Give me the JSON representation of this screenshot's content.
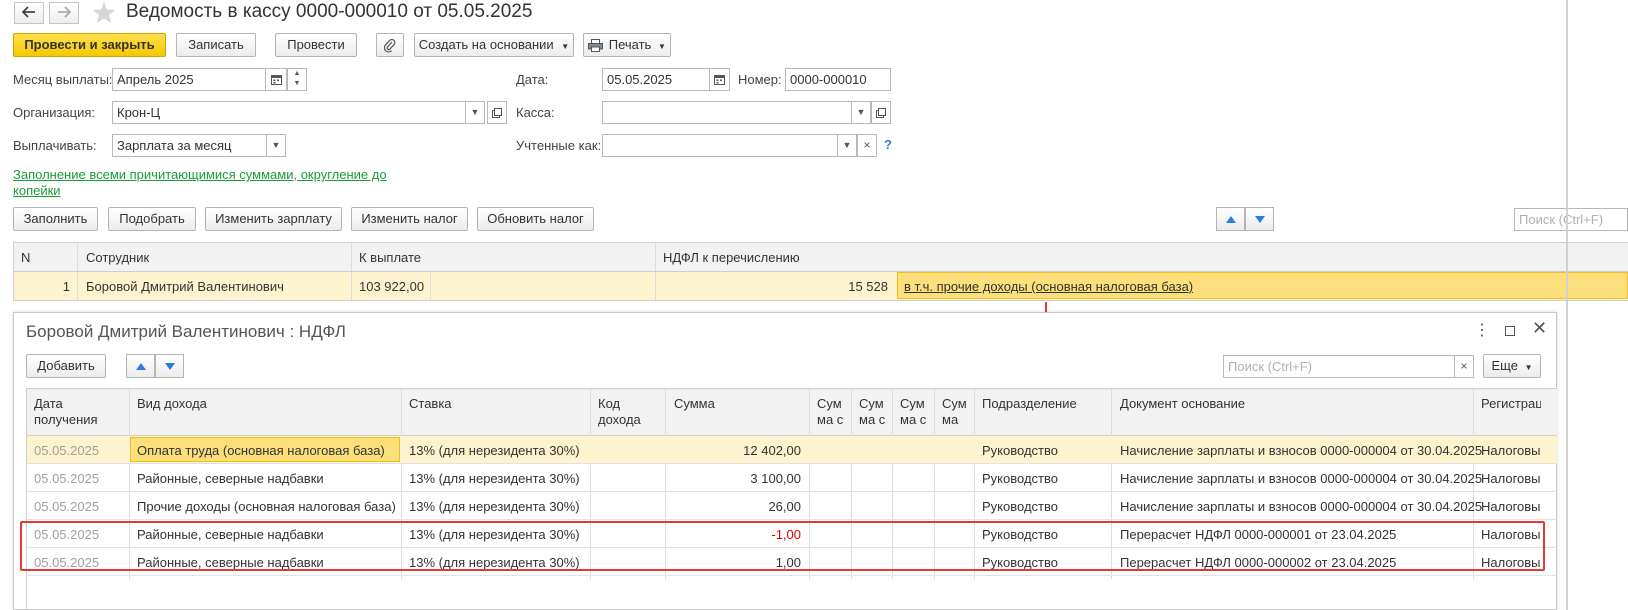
{
  "window": {
    "title": "Ведомость в кассу 0000-000010 от 05.05.2025"
  },
  "toolbar": {
    "post_close": "Провести и закрыть",
    "save": "Записать",
    "post": "Провести",
    "create_based": "Создать на основании",
    "print": "Печать"
  },
  "form": {
    "month_label": "Месяц выплаты:",
    "month_value": "Апрель 2025",
    "org_label": "Организация:",
    "org_value": "Крон-Ц",
    "pay_label": "Выплачивать:",
    "pay_value": "Зарплата за месяц",
    "date_label": "Дата:",
    "date_value": "05.05.2025",
    "number_label": "Номер:",
    "number_value": "0000-000010",
    "cash_label": "Касса:",
    "cash_value": "",
    "accounted_label": "Учтенные как:",
    "accounted_value": "",
    "help": "?",
    "fill_link": "Заполнение всеми причитающимися суммами, округление до копейки"
  },
  "actions": {
    "fill": "Заполнить",
    "pick": "Подобрать",
    "change_salary": "Изменить зарплату",
    "change_tax": "Изменить налог",
    "refresh_tax": "Обновить налог",
    "search_placeholder": "Поиск (Ctrl+F)"
  },
  "main_table": {
    "headers": [
      "N",
      "Сотрудник",
      "К выплате",
      "НДФЛ к перечислению"
    ],
    "row": {
      "n": "1",
      "employee": "Боровой Дмитрий Валентинович",
      "to_pay": "103 922,00",
      "ndfl": "15 528",
      "link": "в т.ч. прочие доходы (основная налоговая база)"
    }
  },
  "subform": {
    "title": "Боровой Дмитрий Валентинович : НДФЛ",
    "add": "Добавить",
    "search_placeholder": "Поиск (Ctrl+F)",
    "clear": "×",
    "more": "Еще",
    "headers": {
      "date": "Дата получения",
      "kind": "Вид дохода",
      "rate": "Ставка",
      "code": "Код дохода",
      "sum": "Сумма",
      "s1": "Сум ма с",
      "s2": "Сум ма с",
      "s3": "Сум ма с",
      "s4": "Сум ма",
      "dept": "Подразделение",
      "doc": "Документ основание",
      "reg": "Регистрац"
    },
    "rows": [
      {
        "date": "05.05.2025",
        "kind": "Оплата труда (основная налоговая база)",
        "rate": "13% (для нерезидента 30%)",
        "sum": "12 402,00",
        "dept": "Руководство",
        "doc": "Начисление зарплаты и взносов 0000-000004 от 30.04.2025",
        "reg": "Налоговый"
      },
      {
        "date": "05.05.2025",
        "kind": "Районные, северные надбавки",
        "rate": "13% (для нерезидента 30%)",
        "sum": "3 100,00",
        "dept": "Руководство",
        "doc": "Начисление зарплаты и взносов 0000-000004 от 30.04.2025",
        "reg": "Налоговый"
      },
      {
        "date": "05.05.2025",
        "kind": "Прочие доходы (основная налоговая база)",
        "rate": "13% (для нерезидента 30%)",
        "sum": "26,00",
        "dept": "Руководство",
        "doc": "Начисление зарплаты и взносов 0000-000004 от 30.04.2025",
        "reg": "Налоговый"
      },
      {
        "date": "05.05.2025",
        "kind": "Районные, северные надбавки",
        "rate": "13% (для нерезидента 30%)",
        "sum": "-1,00",
        "dept": "Руководство",
        "doc": "Перерасчет НДФЛ 0000-000001 от 23.04.2025",
        "reg": "Налоговый"
      },
      {
        "date": "05.05.2025",
        "kind": "Районные, северные надбавки",
        "rate": "13% (для нерезидента 30%)",
        "sum": "1,00",
        "dept": "Руководство",
        "doc": "Перерасчет НДФЛ 0000-000002 от 23.04.2025",
        "reg": "Налоговый"
      }
    ]
  },
  "colors": {
    "accent_yellow": "#f5c800",
    "selected_row": "#fdf3cf",
    "link_green": "#1a9c3a",
    "highlight_red": "#e53935",
    "negative_red": "#e00000"
  }
}
